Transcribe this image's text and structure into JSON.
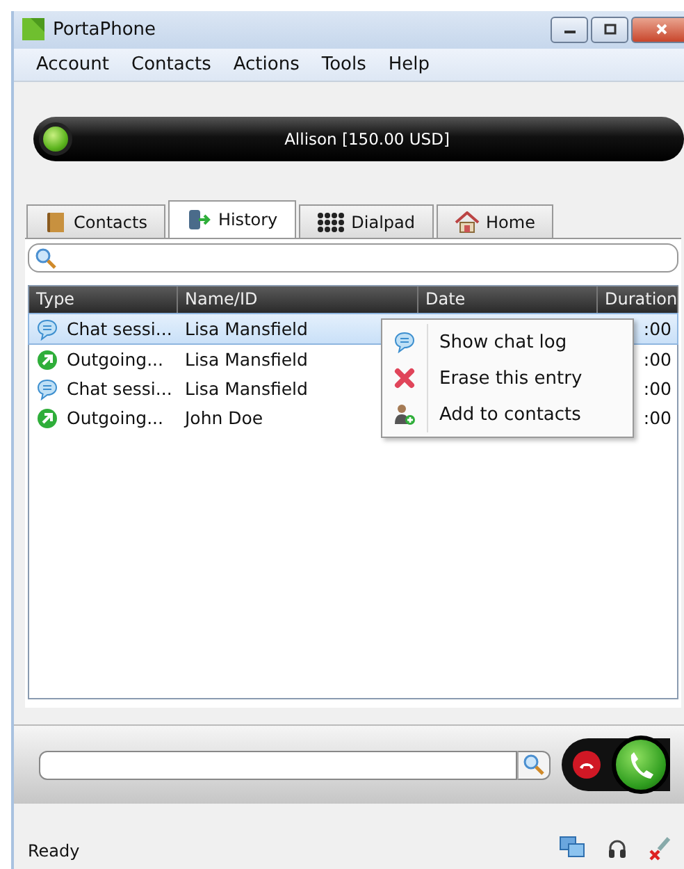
{
  "window": {
    "title": "PortaPhone"
  },
  "menu": [
    "Account",
    "Contacts",
    "Actions",
    "Tools",
    "Help"
  ],
  "account": {
    "label": "Allison [150.00 USD]",
    "online": true
  },
  "tabs": [
    {
      "label": "Contacts",
      "selected": false
    },
    {
      "label": "History",
      "selected": true
    },
    {
      "label": "Dialpad",
      "selected": false
    },
    {
      "label": "Home",
      "selected": false
    }
  ],
  "table": {
    "columns": [
      "Type",
      "Name/ID",
      "Date",
      "Duration"
    ],
    "rows": [
      {
        "kind": "chat",
        "type": "Chat sessi...",
        "name": "Lisa Mansfield",
        "duration": ":00",
        "selected": true
      },
      {
        "kind": "outgoing",
        "type": "Outgoing...",
        "name": "Lisa Mansfield",
        "duration": ":00",
        "selected": false
      },
      {
        "kind": "chat",
        "type": "Chat sessi...",
        "name": "Lisa Mansfield",
        "duration": ":00",
        "selected": false
      },
      {
        "kind": "outgoing",
        "type": "Outgoing...",
        "name": "John Doe",
        "duration": ":00",
        "selected": false
      }
    ]
  },
  "context_menu": [
    {
      "kind": "chat",
      "label": "Show chat log"
    },
    {
      "kind": "erase",
      "label": "Erase this entry"
    },
    {
      "kind": "add",
      "label": "Add to contacts"
    }
  ],
  "status_bar": {
    "text": "Ready"
  }
}
